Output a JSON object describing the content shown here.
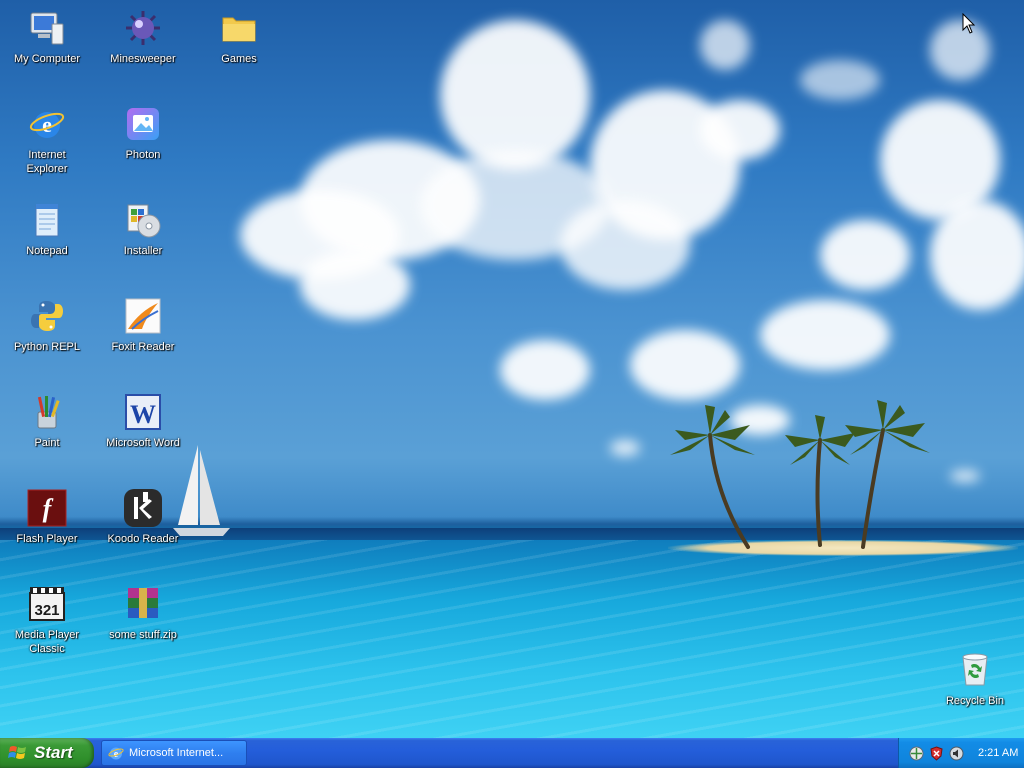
{
  "desktop": {
    "icons": [
      {
        "label": "My Computer",
        "icon": "my-computer-icon"
      },
      {
        "label": "Minesweeper",
        "icon": "minesweeper-icon"
      },
      {
        "label": "Games",
        "icon": "folder-icon"
      },
      {
        "label": "Internet Explorer",
        "icon": "internet-explorer-icon"
      },
      {
        "label": "Photon",
        "icon": "photon-icon"
      },
      {
        "label": "Notepad",
        "icon": "notepad-icon"
      },
      {
        "label": "Installer",
        "icon": "installer-icon"
      },
      {
        "label": "Python REPL",
        "icon": "python-icon"
      },
      {
        "label": "Foxit Reader",
        "icon": "foxit-reader-icon"
      },
      {
        "label": "Paint",
        "icon": "paint-icon"
      },
      {
        "label": "Microsoft Word",
        "icon": "word-icon"
      },
      {
        "label": "Flash Player",
        "icon": "flash-player-icon"
      },
      {
        "label": "Koodo Reader",
        "icon": "koodo-reader-icon"
      },
      {
        "label": "Media Player Classic",
        "icon": "media-player-classic-icon"
      },
      {
        "label": "some stuff.zip",
        "icon": "winrar-archive-icon"
      },
      {
        "label": "Recycle Bin",
        "icon": "recycle-bin-icon"
      }
    ]
  },
  "taskbar": {
    "start_label": "Start",
    "task_label": "Microsoft Internet...",
    "clock": "2:21 AM",
    "tray_icons": [
      "network-icon",
      "security-shield-icon",
      "volume-icon"
    ]
  },
  "colors": {
    "taskbar_blue": "#245edb",
    "start_green": "#3a9a36",
    "tray_blue": "#0f84dc"
  }
}
